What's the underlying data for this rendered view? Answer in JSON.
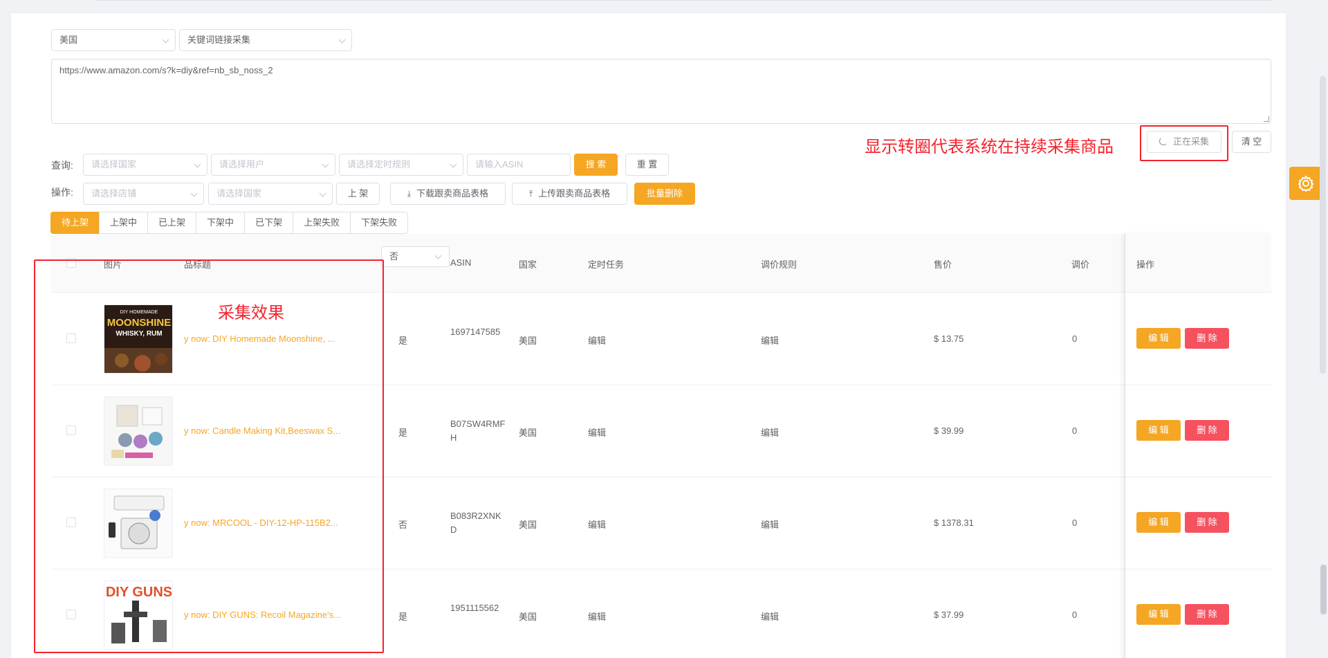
{
  "colors": {
    "accent": "#f5a623",
    "danger": "#f5515f",
    "annotation": "#f5222d"
  },
  "top": {
    "country": "美国",
    "mode": "关键词链接采集",
    "url": "https://www.amazon.com/s?k=diy&ref=nb_sb_noss_2"
  },
  "annotations": {
    "spinner_note": "显示转圈代表系统在持续采集商品",
    "result_note": "采集效果"
  },
  "collect": {
    "collecting_label": "正在采集",
    "clear_label": "清 空"
  },
  "query": {
    "label": "查询:",
    "country_placeholder": "请选择国家",
    "user_placeholder": "请选择用户",
    "rule_placeholder": "请选择定时规则",
    "asin_placeholder": "请输入ASIN",
    "search_label": "搜 索",
    "reset_label": "重 置"
  },
  "ops": {
    "label": "操作:",
    "store_placeholder": "请选择店铺",
    "country_placeholder": "请选择国家",
    "list_label": "上 架",
    "download_label": "下载跟卖商品表格",
    "upload_label": "上传跟卖商品表格",
    "batch_delete_label": "批量删除"
  },
  "tabs": [
    "待上架",
    "上架中",
    "已上架",
    "下架中",
    "已下架",
    "上架失败",
    "下架失败"
  ],
  "filter_popover": {
    "value": "否"
  },
  "table": {
    "headers": {
      "image": "图片",
      "title": "品标题",
      "asin": "ASIN",
      "country": "国家",
      "timer": "定时任务",
      "price_rule": "调价规则",
      "price": "售价",
      "adjust": "调价",
      "action": "操作"
    },
    "rows": [
      {
        "title": "y now: DIY Homemade Moonshine, ...",
        "flag": "是",
        "asin": "1697147585",
        "country": "美国",
        "timer": "编辑",
        "rule": "编辑",
        "price": "$ 13.75",
        "adjust": "0",
        "cover_top": "DIY HOMEMADE",
        "cover_main": "MOONSHINE",
        "cover_sub": "WHISKY, RUM"
      },
      {
        "title": "y now: Candle Making Kit,Beeswax S...",
        "flag": "是",
        "asin": "B07SW4RMFH",
        "country": "美国",
        "timer": "编辑",
        "rule": "编辑",
        "price": "$ 39.99",
        "adjust": "0"
      },
      {
        "title": "y now: MRCOOL - DIY-12-HP-115B2...",
        "flag": "否",
        "asin": "B083R2XNKD",
        "country": "美国",
        "timer": "编辑",
        "rule": "编辑",
        "price": "$ 1378.31",
        "adjust": "0"
      },
      {
        "title": "y now: DIY GUNS: Recoil Magazine's...",
        "flag": "是",
        "asin": "1951115562",
        "country": "美国",
        "timer": "编辑",
        "rule": "编辑",
        "price": "$ 37.99",
        "adjust": "0",
        "cover_main": "DIY GUNS"
      }
    ],
    "edit_label": "编 辑",
    "delete_label": "删 除"
  }
}
